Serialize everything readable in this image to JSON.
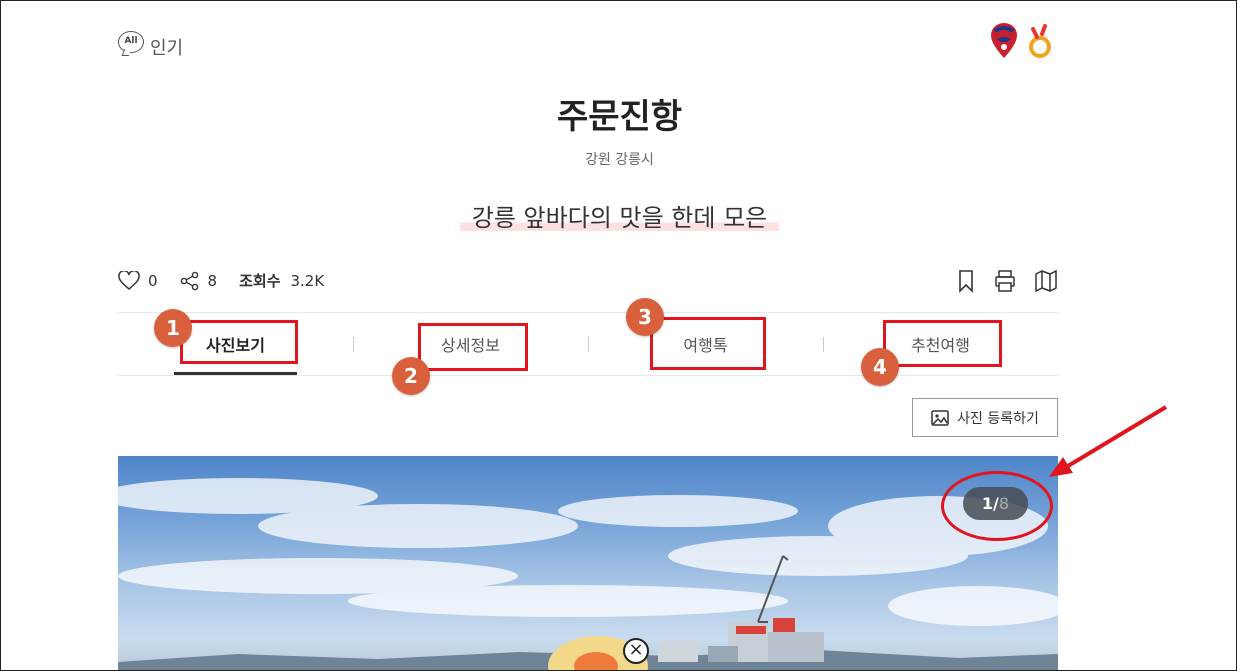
{
  "header": {
    "all_badge": "All",
    "popular_label": "인기"
  },
  "place": {
    "title": "주문진항",
    "region": "강원 강릉시",
    "tagline": "강릉 앞바다의 맛을 한데 모은"
  },
  "stats": {
    "likes": "0",
    "shares": "8",
    "views_label": "조회수",
    "views": "3.2K"
  },
  "tabs": [
    {
      "label": "사진보기",
      "active": true
    },
    {
      "label": "상세정보",
      "active": false
    },
    {
      "label": "여행톡",
      "active": false
    },
    {
      "label": "추천여행",
      "active": false
    }
  ],
  "annotations": [
    "1",
    "2",
    "3",
    "4"
  ],
  "upload_button": "사진 등록하기",
  "gallery": {
    "current": "1",
    "separator": "/",
    "total": "8"
  },
  "colors": {
    "highlight": "#e0151f",
    "badge": "#d9603d",
    "tagline_mark": "#fde0e0"
  },
  "icons": [
    "heart-icon",
    "share-icon",
    "bookmark-icon",
    "print-icon",
    "map-icon",
    "image-icon",
    "close-icon"
  ]
}
